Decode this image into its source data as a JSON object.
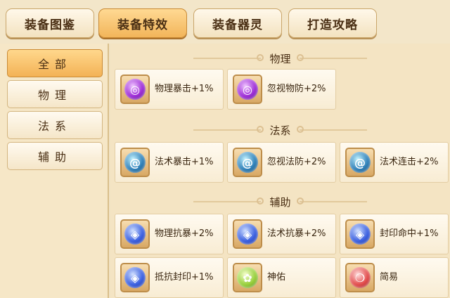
{
  "tabs": [
    {
      "label": "装备图鉴"
    },
    {
      "label": "装备特效"
    },
    {
      "label": "装备器灵"
    },
    {
      "label": "打造攻略"
    }
  ],
  "sidebar": {
    "items": [
      {
        "label": "全部"
      },
      {
        "label": "物理"
      },
      {
        "label": "法系"
      },
      {
        "label": "辅助"
      }
    ]
  },
  "sections": [
    {
      "title": "物理",
      "cards": [
        {
          "label": "物理暴击+1%",
          "icon": "purple-vortex-icon"
        },
        {
          "label": "忽视物防+2%",
          "icon": "purple-vortex-icon"
        }
      ]
    },
    {
      "title": "法系",
      "cards": [
        {
          "label": "法术暴击+1%",
          "icon": "teal-swirl-icon"
        },
        {
          "label": "忽视法防+2%",
          "icon": "teal-swirl-icon"
        },
        {
          "label": "法术连击+2%",
          "icon": "teal-swirl-icon"
        }
      ]
    },
    {
      "title": "辅助",
      "cards": [
        {
          "label": "物理抗暴+2%",
          "icon": "blue-shield-icon"
        },
        {
          "label": "法术抗暴+2%",
          "icon": "blue-shield-icon"
        },
        {
          "label": "封印命中+1%",
          "icon": "blue-shield-icon"
        },
        {
          "label": "抵抗封印+1%",
          "icon": "blue-shield-icon"
        },
        {
          "label": "神佑",
          "icon": "green-blessing-icon"
        },
        {
          "label": "简易",
          "icon": "red-orb-icon"
        }
      ]
    }
  ]
}
